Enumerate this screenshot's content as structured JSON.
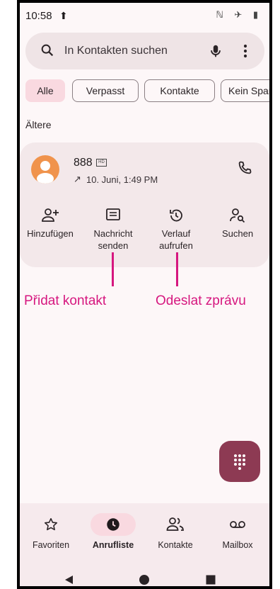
{
  "status_bar": {
    "time": "10:58",
    "upload_glyph": "⬆",
    "right_icons": "ℕ ✈ ▮"
  },
  "search": {
    "placeholder": "In Kontakten suchen"
  },
  "filters": [
    {
      "label": "Alle",
      "active": true
    },
    {
      "label": "Verpasst",
      "active": false
    },
    {
      "label": "Kontakte",
      "active": false
    },
    {
      "label": "Kein Spam",
      "active": false
    }
  ],
  "section_title": "Ältere",
  "call_entry": {
    "name": "888",
    "hd_badge": "HD",
    "direction_glyph": "↗",
    "date": "10. Juni, 1:49 PM",
    "actions": [
      {
        "label_line1": "Hinzufügen",
        "label_line2": "",
        "icon": "add-person-icon"
      },
      {
        "label_line1": "Nachricht",
        "label_line2": "senden",
        "icon": "message-icon"
      },
      {
        "label_line1": "Verlauf",
        "label_line2": "aufrufen",
        "icon": "history-icon"
      },
      {
        "label_line1": "Suchen",
        "label_line2": "",
        "icon": "search-person-icon"
      }
    ]
  },
  "annotations": {
    "left": "Přidat kontakt",
    "right": "Odeslat zprávu"
  },
  "bottom_nav": [
    {
      "label": "Favoriten",
      "icon": "star-icon",
      "active": false
    },
    {
      "label": "Anrufliste",
      "icon": "clock-icon",
      "active": true
    },
    {
      "label": "Kontakte",
      "icon": "people-icon",
      "active": false
    },
    {
      "label": "Mailbox",
      "icon": "voicemail-icon",
      "active": false
    }
  ],
  "colors": {
    "accent": "#8d3a53",
    "annotation": "#d6177f",
    "chip_active": "#f9d9e0",
    "avatar": "#f0934c"
  }
}
